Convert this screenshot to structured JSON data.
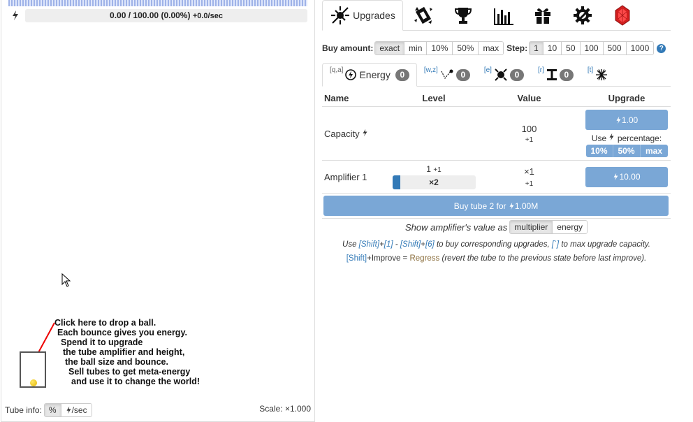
{
  "energy": {
    "current": "0.00",
    "max": "100.00",
    "percent": "(0.00%)",
    "rate": "+0.0/sec",
    "fill_fraction": 0.0
  },
  "hint": {
    "lines": [
      "Click here to drop a ball.",
      "Each bounce gives you energy.",
      "Spend it to upgrade",
      "the tube amplifier and height,",
      "the ball size and bounce.",
      "Sell tubes to get meta-energy",
      "and use it to change the world!"
    ]
  },
  "tube_info": {
    "label": "Tube info:",
    "options": [
      "%",
      "/sec"
    ],
    "selected": "%"
  },
  "scale": "Scale: ×1.000",
  "main_tabs": [
    {
      "icon": "upgrades-icon",
      "label": "Upgrades",
      "active": true
    },
    {
      "icon": "machine-icon",
      "label": "",
      "active": false
    },
    {
      "icon": "trophy-icon",
      "label": "",
      "active": false
    },
    {
      "icon": "statistics-icon",
      "label": "",
      "active": false
    },
    {
      "icon": "gift-icon",
      "label": "",
      "active": false
    },
    {
      "icon": "settings-icon",
      "label": "",
      "active": false
    },
    {
      "icon": "ruby-icon",
      "label": "",
      "active": false
    }
  ],
  "buy_amount": {
    "label": "Buy amount:",
    "options": [
      "exact",
      "min",
      "10%",
      "50%",
      "max"
    ],
    "selected": "exact"
  },
  "step": {
    "label": "Step:",
    "options": [
      "1",
      "10",
      "50",
      "100",
      "500",
      "1000"
    ],
    "selected": "1"
  },
  "sub_tabs": [
    {
      "hotkey": "[q,a]",
      "icon": "energy-icon",
      "label": "Energy",
      "count": "0",
      "active": true
    },
    {
      "hotkey": "[w,z]",
      "icon": "bounce-icon",
      "label": "",
      "count": "0",
      "active": false
    },
    {
      "hotkey": "[e]",
      "icon": "ball-icon",
      "label": "",
      "count": "0",
      "active": false
    },
    {
      "hotkey": "[r]",
      "icon": "height-icon",
      "label": "",
      "count": "0",
      "active": false
    },
    {
      "hotkey": "[t]",
      "icon": "spark-icon",
      "label": "",
      "count": "",
      "active": false
    }
  ],
  "table": {
    "headers": {
      "name": "Name",
      "level": "Level",
      "value": "Value",
      "upgrade": "Upgrade"
    },
    "capacity": {
      "name": "Capacity",
      "value": "100",
      "value_plus": "+1",
      "cost": "1.00",
      "use_label_pre": "Use",
      "use_label_post": "percentage:",
      "pct_options": [
        "10%",
        "50%",
        "max"
      ]
    },
    "amplifier": {
      "name": "Amplifier 1",
      "level": "1",
      "level_plus": "+1",
      "bar_text": "×2",
      "bar_fraction": 0.1,
      "value": "×1",
      "value_plus": "+1",
      "cost": "10.00"
    }
  },
  "buy_tube": {
    "pre": "Buy tube 2 for",
    "cost": "1.00M"
  },
  "show_amp": {
    "label": "Show amplifier's value as",
    "options": [
      "multiplier",
      "energy"
    ],
    "selected": "multiplier"
  },
  "notes": {
    "line1_a": "Use",
    "shift": "[Shift]",
    "k1": "[1]",
    "k6": "[6]",
    "line1_b": "to buy corresponding upgrades,",
    "backtick": "[`]",
    "line1_c": "to max upgrade capacity.",
    "improve": "+Improve =",
    "regress": "Regress",
    "line2_c": "(revert the tube to the previous state before last improve)."
  },
  "colors": {
    "button_blue": "#7aa7d6",
    "link_blue": "#337ab7",
    "badge_gray": "#777777",
    "regress_brown": "#8a6d3b"
  }
}
